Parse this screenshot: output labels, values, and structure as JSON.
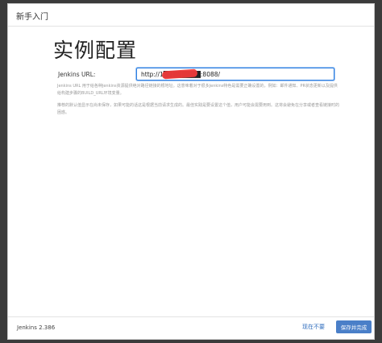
{
  "dialog": {
    "title": "新手入门",
    "heading": "实例配置"
  },
  "form": {
    "url_label": "Jenkins URL:",
    "url_value": "http://1████████:8088/",
    "help1": "Jenkins URL 用于给各种Jenkins资源提供绝对路径链接的根地址。这意味着对于很多Jenkins特色是需要正确设置的，例如：邮件通知、PR状态更新以及提供给构建步骤的BUILD_URL环境变量。",
    "help2": "推荐的默认值显示在尚未保存，如果可能的话这是根据当前请求生成的。最佳实践是要设置这个值，用户可能会需要用到。这将会避免在分享或者查看链接时的困惑。"
  },
  "footer": {
    "version": "Jenkins 2.386",
    "skip_label": "现在不要",
    "save_label": "保存并完成"
  },
  "colors": {
    "primary": "#4a7fc8",
    "focus": "#2f7fe0",
    "redaction": "#ef3a3a"
  }
}
